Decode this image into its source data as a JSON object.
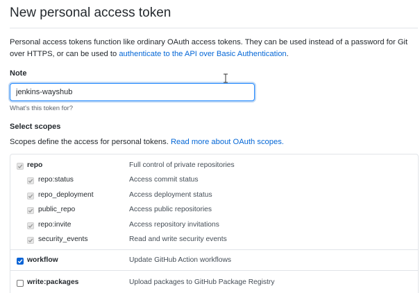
{
  "page": {
    "title": "New personal access token",
    "intro_text": "Personal access tokens function like ordinary OAuth access tokens. They can be used instead of a password for Git over HTTPS, or can be used to ",
    "intro_link": "authenticate to the API over Basic Authentication",
    "intro_end": "."
  },
  "note": {
    "label": "Note",
    "value": "jenkins-wayshub",
    "hint": "What's this token for?"
  },
  "scopes": {
    "label": "Select scopes",
    "desc_text": "Scopes define the access for personal tokens. ",
    "desc_link": "Read more about OAuth scopes.",
    "items": [
      {
        "name": "repo",
        "description": "Full control of private repositories",
        "checked": true,
        "disabled": true,
        "parent": true
      },
      {
        "name": "repo:status",
        "description": "Access commit status",
        "checked": true,
        "disabled": true,
        "parent": false
      },
      {
        "name": "repo_deployment",
        "description": "Access deployment status",
        "checked": true,
        "disabled": true,
        "parent": false
      },
      {
        "name": "public_repo",
        "description": "Access public repositories",
        "checked": true,
        "disabled": true,
        "parent": false
      },
      {
        "name": "repo:invite",
        "description": "Access repository invitations",
        "checked": true,
        "disabled": true,
        "parent": false
      },
      {
        "name": "security_events",
        "description": "Read and write security events",
        "checked": true,
        "disabled": true,
        "parent": false
      },
      {
        "name": "workflow",
        "description": "Update GitHub Action workflows",
        "checked": true,
        "disabled": false,
        "parent": true
      },
      {
        "name": "write:packages",
        "description": "Upload packages to GitHub Package Registry",
        "checked": false,
        "disabled": false,
        "parent": true
      }
    ]
  },
  "colors": {
    "link": "#0366d6",
    "checkbox_checked": "#0a64d6",
    "input_focus": "#2188ff"
  }
}
